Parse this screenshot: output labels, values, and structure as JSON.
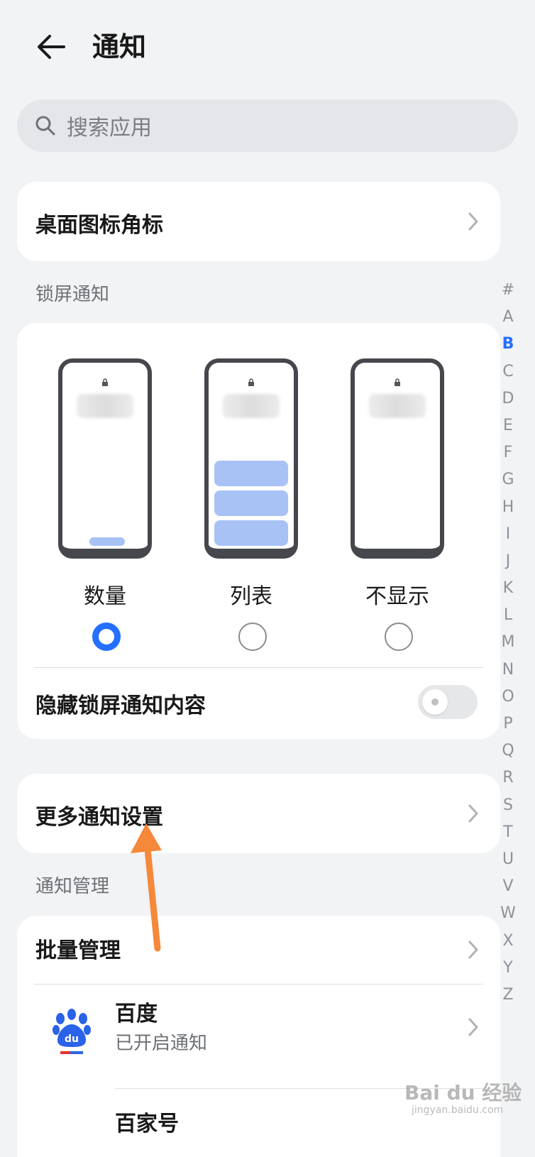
{
  "header": {
    "title": "通知"
  },
  "search": {
    "placeholder": "搜索应用"
  },
  "badge_row": {
    "label": "桌面图标角标"
  },
  "lockscreen": {
    "section_label": "锁屏通知",
    "options": [
      {
        "label": "数量",
        "selected": true
      },
      {
        "label": "列表",
        "selected": false
      },
      {
        "label": "不显示",
        "selected": false
      }
    ],
    "hide_content": {
      "label": "隐藏锁屏通知内容",
      "enabled": false
    }
  },
  "more_settings": {
    "label": "更多通知设置"
  },
  "management": {
    "section_label": "通知管理",
    "batch": {
      "label": "批量管理"
    },
    "apps": [
      {
        "name": "百度",
        "status": "已开启通知",
        "icon": "baidu-paw-icon"
      },
      {
        "name": "百家号",
        "status": ""
      }
    ]
  },
  "alpha_index": [
    "#",
    "A",
    "B",
    "C",
    "D",
    "E",
    "F",
    "G",
    "H",
    "I",
    "J",
    "K",
    "L",
    "M",
    "N",
    "O",
    "P",
    "Q",
    "R",
    "S",
    "T",
    "U",
    "V",
    "W",
    "X",
    "Y",
    "Z"
  ],
  "alpha_index_active": "B",
  "colors": {
    "accent": "#256fff",
    "preview_bar": "#a8c2f5",
    "annotation_arrow": "#f5883a"
  },
  "watermark": {
    "brand": "Bai du 经验",
    "url": "jingyan.baidu.com"
  }
}
